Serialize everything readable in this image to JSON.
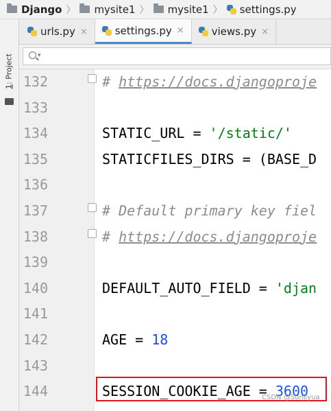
{
  "breadcrumb": {
    "items": [
      {
        "label": "Django",
        "icon": "folder-icon"
      },
      {
        "label": "mysite1",
        "icon": "folder-icon"
      },
      {
        "label": "mysite1",
        "icon": "folder-icon"
      },
      {
        "label": "settings.py",
        "icon": "python-file-icon"
      }
    ]
  },
  "side_panel": {
    "label_prefix": "1",
    "label_rest": ": Project"
  },
  "tabs": [
    {
      "label": "urls.py",
      "close": "×",
      "active": false
    },
    {
      "label": "settings.py",
      "close": "×",
      "active": true
    },
    {
      "label": "views.py",
      "close": "×",
      "active": false
    }
  ],
  "search": {
    "value": "",
    "caret": "▾"
  },
  "editor": {
    "lines": [
      {
        "n": "132",
        "text": "# https://docs.djangoproje"
      },
      {
        "n": "133",
        "text": ""
      },
      {
        "n": "134",
        "text": "STATIC_URL = '/static/'"
      },
      {
        "n": "135",
        "text": "STATICFILES_DIRS = (BASE_D"
      },
      {
        "n": "136",
        "text": ""
      },
      {
        "n": "137",
        "text": "# Default primary key fiel"
      },
      {
        "n": "138",
        "text": "# https://docs.djangoproje"
      },
      {
        "n": "139",
        "text": ""
      },
      {
        "n": "140",
        "text": "DEFAULT_AUTO_FIELD = 'djan"
      },
      {
        "n": "141",
        "text": ""
      },
      {
        "n": "142",
        "text": "AGE = 18"
      },
      {
        "n": "143",
        "text": ""
      },
      {
        "n": "144",
        "text": "SESSION_COOKIE_AGE = 3600"
      }
    ],
    "tokens": {
      "l132_hash": "# ",
      "l132_url": "https://docs.djangoproje",
      "l134_a": "STATIC_URL = ",
      "l134_s": "'/static/'",
      "l135": "STATICFILES_DIRS = (BASE_D",
      "l137": "# Default primary key fiel",
      "l138_hash": "# ",
      "l138_url": "https://docs.djangoproje",
      "l140_a": "DEFAULT_AUTO_FIELD = ",
      "l140_s": "'djan",
      "l142_a": "AGE = ",
      "l142_n": "18",
      "l144_a": "SESSION_COOKIE_AGE = ",
      "l144_n": "3600"
    }
  },
  "watermark": "CSDN @Sunjiyua",
  "colors": {
    "highlight": "#e0141e",
    "string": "#067d17",
    "number": "#1750eb",
    "comment": "#8c8c8c"
  }
}
